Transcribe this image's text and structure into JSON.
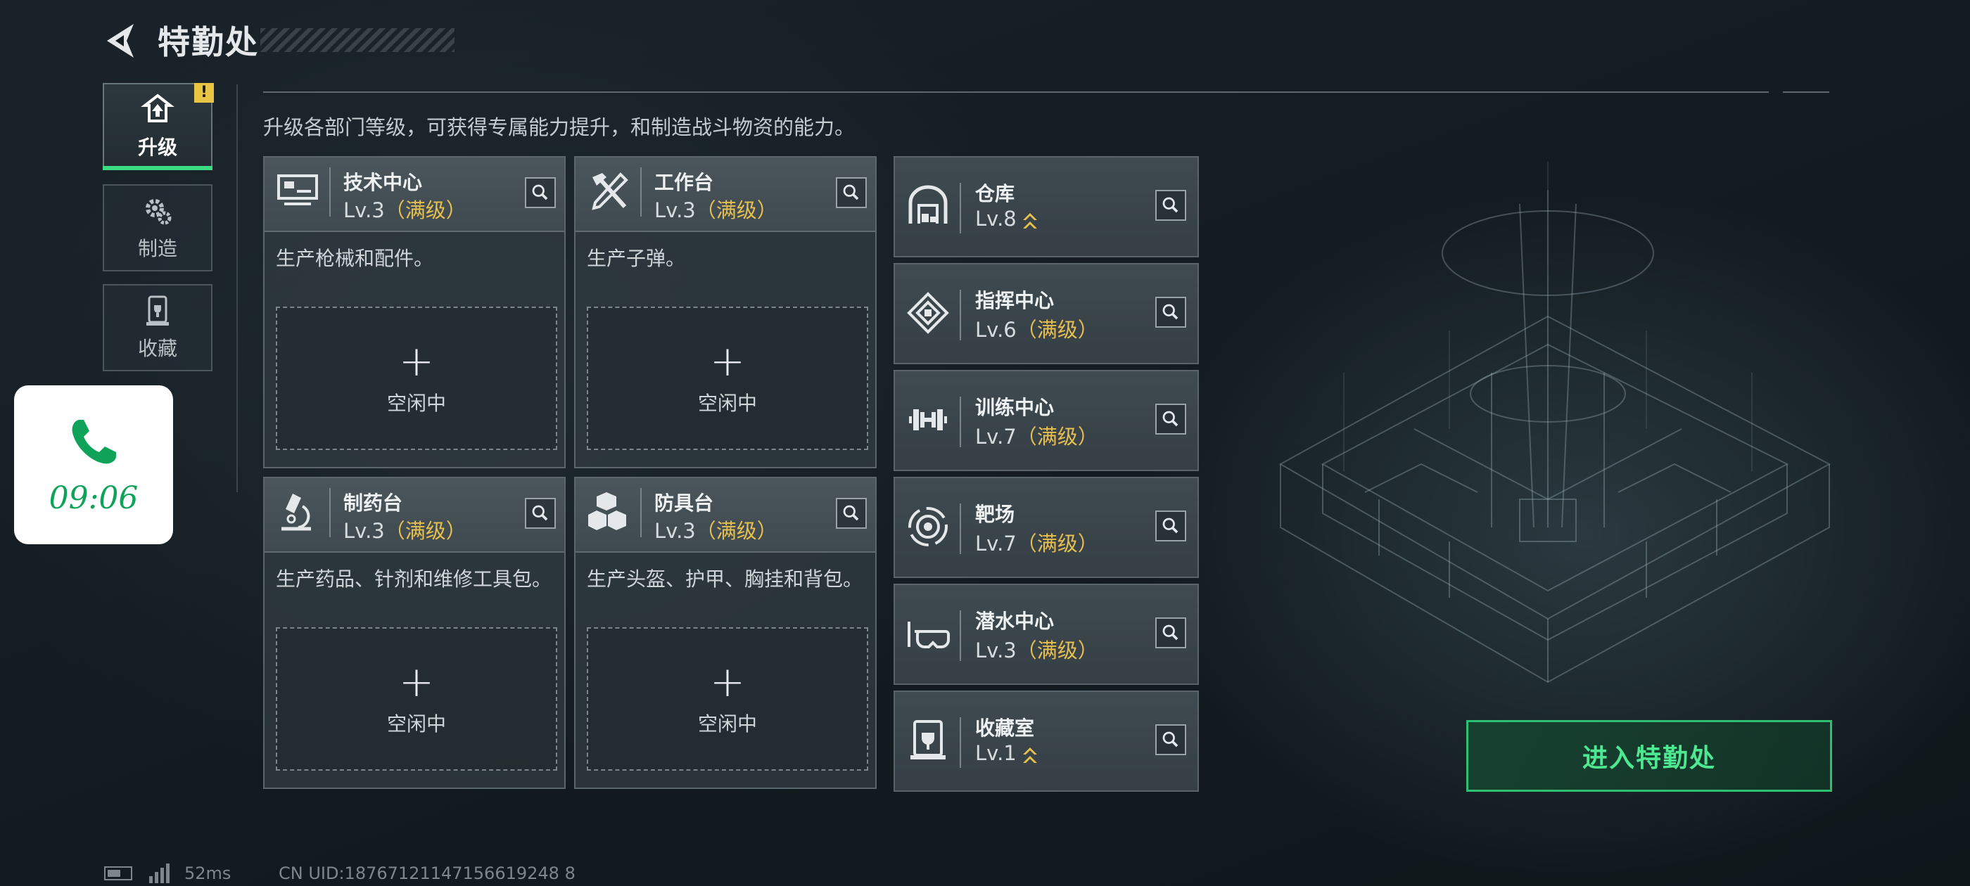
{
  "header": {
    "title": "特勤处"
  },
  "tabs": [
    {
      "label": "升级",
      "icon": "upgrade-icon",
      "active": true,
      "alert": "!"
    },
    {
      "label": "制造",
      "icon": "gear-icon",
      "active": false
    },
    {
      "label": "收藏",
      "icon": "trophy-case-icon",
      "active": false
    }
  ],
  "phone": {
    "time": "09:06",
    "icon": "phone-icon"
  },
  "intro": "升级各部门等级，可获得专属能力提升，和制造战斗物资的能力。",
  "production": [
    {
      "name": "技术中心",
      "level": "Lv.3",
      "status": "（满级）",
      "desc": "生产枪械和配件。",
      "slot_plus": "+",
      "slot_label": "空闲中",
      "icon": "tech-center-icon"
    },
    {
      "name": "工作台",
      "level": "Lv.3",
      "status": "（满级）",
      "desc": "生产子弹。",
      "slot_plus": "+",
      "slot_label": "空闲中",
      "icon": "workbench-tools-icon"
    },
    {
      "name": "制药台",
      "level": "Lv.3",
      "status": "（满级）",
      "desc": "生产药品、针剂和维修工具包。",
      "slot_plus": "+",
      "slot_label": "空闲中",
      "icon": "microscope-icon"
    },
    {
      "name": "防具台",
      "level": "Lv.3",
      "status": "（满级）",
      "desc": "生产头盔、护甲、胸挂和背包。",
      "slot_plus": "+",
      "slot_label": "空闲中",
      "icon": "armor-boxes-icon"
    }
  ],
  "facilities": [
    {
      "name": "仓库",
      "level": "Lv.8",
      "status": "",
      "upgradable": true,
      "icon": "warehouse-icon"
    },
    {
      "name": "指挥中心",
      "level": "Lv.6",
      "status": "（满级）",
      "upgradable": false,
      "icon": "command-center-icon"
    },
    {
      "name": "训练中心",
      "level": "Lv.7",
      "status": "（满级）",
      "upgradable": false,
      "icon": "dumbbell-icon"
    },
    {
      "name": "靶场",
      "level": "Lv.7",
      "status": "（满级）",
      "upgradable": false,
      "icon": "target-icon"
    },
    {
      "name": "潜水中心",
      "level": "Lv.3",
      "status": "（满级）",
      "upgradable": false,
      "icon": "diving-mask-icon"
    },
    {
      "name": "收藏室",
      "level": "Lv.1",
      "status": "",
      "upgradable": true,
      "icon": "collection-room-icon"
    }
  ],
  "enter_button": "进入特勤处",
  "footer": {
    "ping": "52ms",
    "uid": "CN UID:18767121147156619248 8"
  },
  "colors": {
    "accent_green": "#3ddc84",
    "max_level_gold": "#e7bf4f",
    "phone_green": "#0fa35a"
  }
}
